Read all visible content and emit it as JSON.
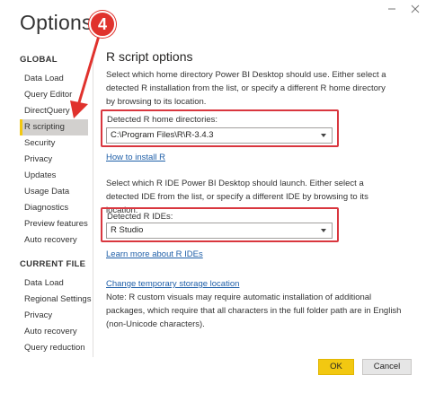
{
  "window": {
    "title": "Options"
  },
  "sidebar": {
    "global_head": "GLOBAL",
    "global_items": [
      {
        "label": "Data Load"
      },
      {
        "label": "Query Editor"
      },
      {
        "label": "DirectQuery"
      },
      {
        "label": "R scripting"
      },
      {
        "label": "Security"
      },
      {
        "label": "Privacy"
      },
      {
        "label": "Updates"
      },
      {
        "label": "Usage Data"
      },
      {
        "label": "Diagnostics"
      },
      {
        "label": "Preview features"
      },
      {
        "label": "Auto recovery"
      }
    ],
    "current_head": "CURRENT FILE",
    "current_items": [
      {
        "label": "Data Load"
      },
      {
        "label": "Regional Settings"
      },
      {
        "label": "Privacy"
      },
      {
        "label": "Auto recovery"
      },
      {
        "label": "Query reduction"
      }
    ],
    "selected": "R scripting"
  },
  "main": {
    "heading": "R script options",
    "home_desc": "Select which home directory Power BI Desktop should use. Either select a detected R installation from the list, or specify a different R home directory by browsing to its location.",
    "home_label": "Detected R home directories:",
    "home_value": "C:\\Program Files\\R\\R-3.4.3",
    "install_link": "How to install R",
    "ide_desc": "Select which R IDE Power BI Desktop should launch. Either select a detected IDE from the list, or specify a different IDE by browsing to its location.",
    "ide_label": "Detected R IDEs:",
    "ide_value": "R Studio",
    "ide_link": "Learn more about R IDEs",
    "storage_link": "Change temporary storage location",
    "note": "Note: R custom visuals may require automatic installation of additional packages, which require that all characters in the full folder path are in English (non-Unicode characters)."
  },
  "footer": {
    "ok_label": "OK",
    "cancel_label": "Cancel"
  },
  "annotation": {
    "step_number": "4",
    "color": "#e0322d"
  },
  "colors": {
    "accent": "#f2c811",
    "link": "#1f5fa8",
    "highlight": "#d9363e"
  }
}
